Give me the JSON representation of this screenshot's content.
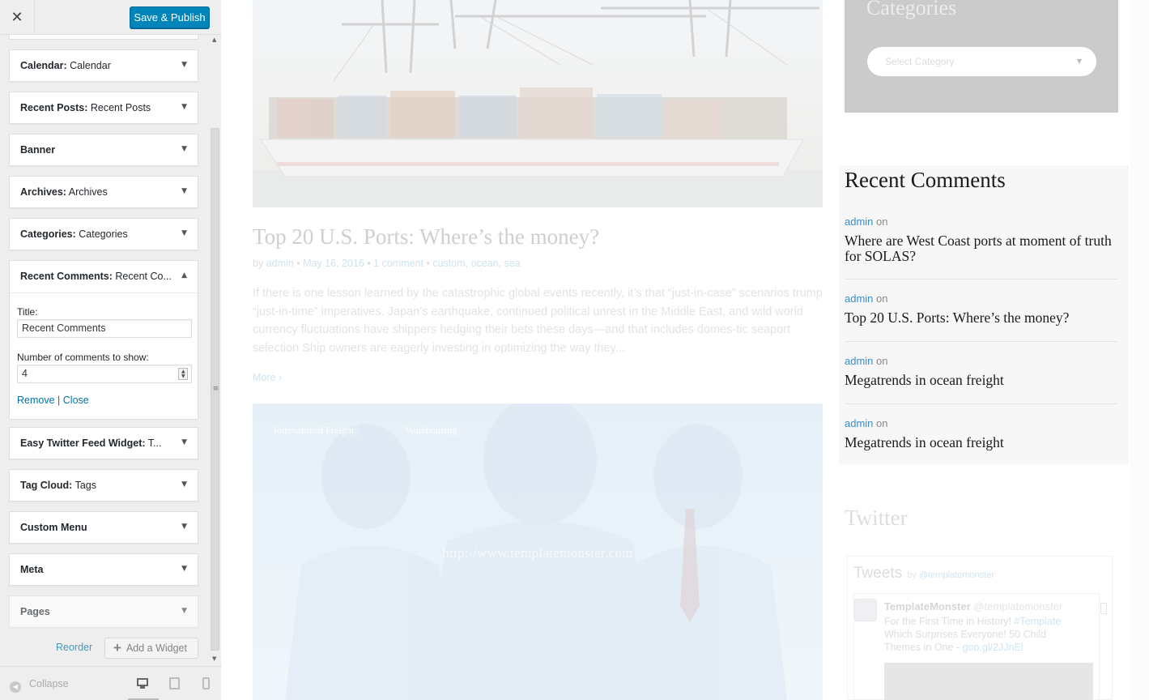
{
  "customizer": {
    "close_glyph": "✕",
    "save_label": "Save & Publish",
    "widgets": [
      {
        "type": "Calendar:",
        "name": "Calendar"
      },
      {
        "type": "Recent Posts:",
        "name": "Recent Posts"
      },
      {
        "type": "Banner",
        "name": ""
      },
      {
        "type": "Archives:",
        "name": "Archives"
      },
      {
        "type": "Categories:",
        "name": "Categories"
      },
      {
        "type": "Easy Twitter Feed Widget:",
        "name": "T..."
      },
      {
        "type": "Tag Cloud:",
        "name": "Tags"
      },
      {
        "type": "Custom Menu",
        "name": ""
      },
      {
        "type": "Meta",
        "name": ""
      },
      {
        "type": "Pages",
        "name": ""
      }
    ],
    "open_widget": {
      "type": "Recent Comments:",
      "name": "Recent Co...",
      "title_label": "Title:",
      "title_value": "Recent Comments",
      "number_label": "Number of comments to show:",
      "number_value": "4",
      "remove_label": "Remove",
      "separator": "|",
      "close_label": "Close"
    },
    "reorder_label": "Reorder",
    "add_widget_label": "Add a Widget",
    "collapse_label": "Collapse"
  },
  "preview": {
    "post": {
      "title": "Top 20 U.S. Ports: Where’s the money?",
      "meta_by": "by",
      "meta_author": "admin",
      "meta_date": "May 16, 2016",
      "meta_comments": "1 comment",
      "meta_tags": "custom, ocean, sea",
      "excerpt": "If there is one lesson learned by the catastrophic global events recently, it’s that “just-in-case” scenarios trump “just-in-time” imperatives. Japan’s earthquake, continued political unrest in the Middle East, and wild world currency fluctuations have shippers hedging their bets these days—and that includes domes-tic seaport selection Ship owners are eagerly investing in optimizing the way they...",
      "more_label": "More",
      "more_arrow": "›"
    },
    "post2": {
      "tags": [
        "International Freight",
        "Warehousing"
      ],
      "url": "http://www.templatemonster.com"
    },
    "categories": {
      "title": "Categories",
      "select_placeholder": "Select Category"
    },
    "recent_comments": {
      "title": "Recent Comments",
      "items": [
        {
          "author": "admin",
          "on": "on",
          "post": "Where are West Coast ports at moment of truth for SOLAS?"
        },
        {
          "author": "admin",
          "on": "on",
          "post": "Top 20 U.S. Ports: Where’s the money?"
        },
        {
          "author": "admin",
          "on": "on",
          "post": "Megatrends in ocean freight"
        },
        {
          "author": "admin",
          "on": "on",
          "post": "Megatrends in ocean freight"
        }
      ]
    },
    "twitter": {
      "title": "Twitter",
      "tweets_label": "Tweets",
      "by_label": "by",
      "handle": "@templatemonster",
      "tweet_name": "TemplateMonster",
      "tweet_handle": "@templatemonster",
      "tweet_text_1": "For the First Time in History!",
      "tweet_hashtag": "#Template",
      "tweet_text_2": "Which Surprises Everyone! 50 Child Themes in One -",
      "tweet_link": "goo.gl/2JJnEl"
    }
  }
}
